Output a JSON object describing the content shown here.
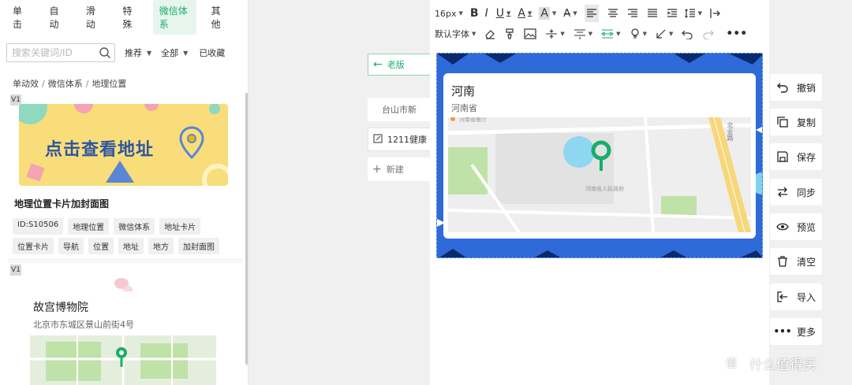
{
  "left": {
    "tabs": [
      "单击",
      "自动",
      "滑动",
      "特殊",
      "微信体系",
      "其他"
    ],
    "search_placeholder": "搜索关键词/ID",
    "sort_select": "推荐",
    "filter_select": "全部",
    "favorites": "已收藏",
    "breadcrumb": [
      "单动效",
      "微信体系",
      "地理位置"
    ],
    "card1": {
      "badge": "V1",
      "banner_text": "点击查看地址",
      "title": "地理位置卡片加封面图",
      "tags": [
        "ID:S10506",
        "地理位置",
        "微信体系",
        "地址卡片",
        "位置卡片",
        "导航",
        "位置",
        "地址",
        "地方",
        "加封面图"
      ]
    },
    "card2": {
      "badge": "V1",
      "title": "故宫博物院",
      "subtitle": "北京市东城区景山前街4号"
    }
  },
  "middle": {
    "old_label": "老版",
    "city_label": "台山市新",
    "health_label": "1211健康",
    "new_label": "新建"
  },
  "toolbar": {
    "font_size": "16px",
    "default_font": "默认字体"
  },
  "editor": {
    "title": "河南",
    "subtitle": "河南省",
    "map_labels": {
      "restaurant": "河南省餐厅",
      "government": "河南省人民政府",
      "road": "北业路"
    }
  },
  "side_actions": [
    {
      "label": "撤销",
      "icon": "undo-icon"
    },
    {
      "label": "复制",
      "icon": "copy-icon"
    },
    {
      "label": "保存",
      "icon": "save-icon"
    },
    {
      "label": "同步",
      "icon": "sync-icon"
    },
    {
      "label": "预览",
      "icon": "eye-icon"
    },
    {
      "label": "清空",
      "icon": "trash-icon"
    },
    {
      "label": "导入",
      "icon": "import-icon"
    },
    {
      "label": "更多",
      "icon": "more-icon"
    }
  ],
  "watermark": "什么值得买",
  "colors": {
    "accent": "#1aad6a",
    "content_blue": "#2e6bd8",
    "banner_yellow": "#f8dd7a",
    "pin_green": "#1aad6a"
  }
}
